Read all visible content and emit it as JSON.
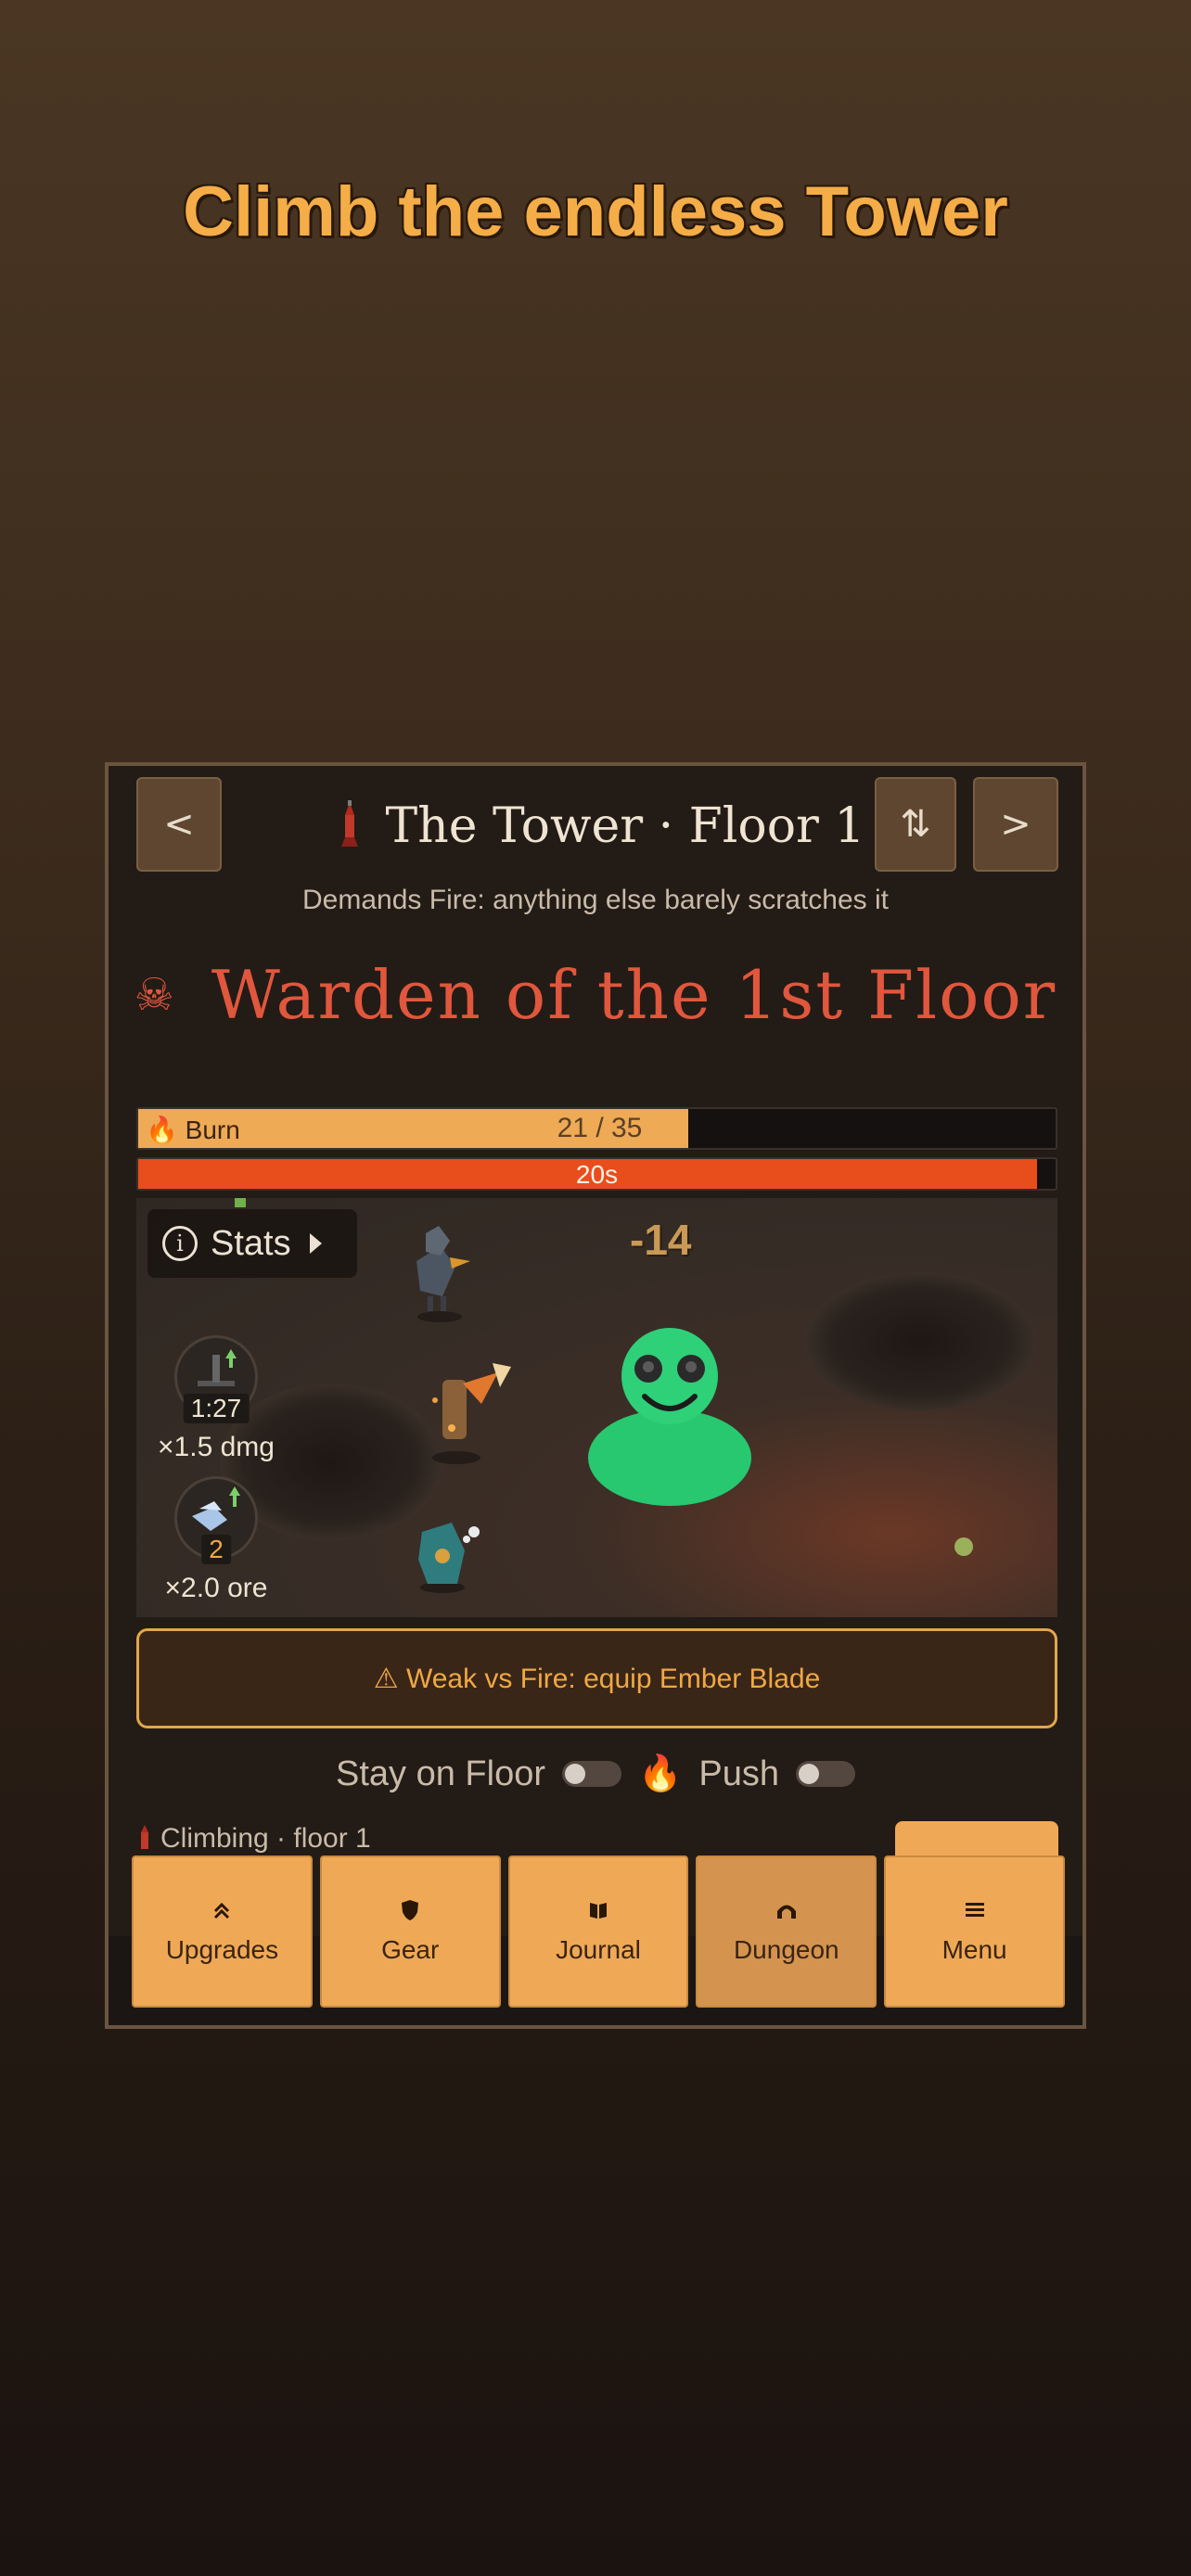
{
  "headline": "Climb the endless Tower",
  "header": {
    "prev_label": "<",
    "next_label": ">",
    "swap_label": "⇅",
    "title": "The Tower · Floor 1",
    "subtitle": "Demands Fire: anything else barely scratches it"
  },
  "boss": {
    "name": "Warden of the 1st Floor"
  },
  "burn_bar": {
    "label": "Burn",
    "value_text": "21 / 35",
    "current": 21,
    "max": 35
  },
  "timer_bar": {
    "label": "20s",
    "fill_fraction": 0.98
  },
  "arena": {
    "stats_label": "Stats",
    "damage_popup": "-14",
    "buffs": [
      {
        "timer": "1:27",
        "desc": "×1.5 dmg"
      },
      {
        "timer": "2",
        "desc": "×2.0 ore"
      }
    ]
  },
  "warning": {
    "text": "⚠ Weak vs Fire: equip Ember Blade"
  },
  "toggles": {
    "stay_label": "Stay on Floor",
    "push_label": "Push"
  },
  "status": {
    "climbing": "Climbing · floor 1"
  },
  "nav": [
    {
      "label": "Upgrades",
      "icon": "double-chevron-up-icon",
      "glyph": "⌃"
    },
    {
      "label": "Gear",
      "icon": "shield-icon",
      "glyph": "⬟"
    },
    {
      "label": "Journal",
      "icon": "book-icon",
      "glyph": "▮"
    },
    {
      "label": "Dungeon",
      "icon": "arch-icon",
      "glyph": "∩"
    },
    {
      "label": "Menu",
      "icon": "menu-icon",
      "glyph": "≡"
    }
  ],
  "colors": {
    "accent": "#efa956",
    "boss_red": "#e0573d",
    "timer": "#e84e1c"
  }
}
